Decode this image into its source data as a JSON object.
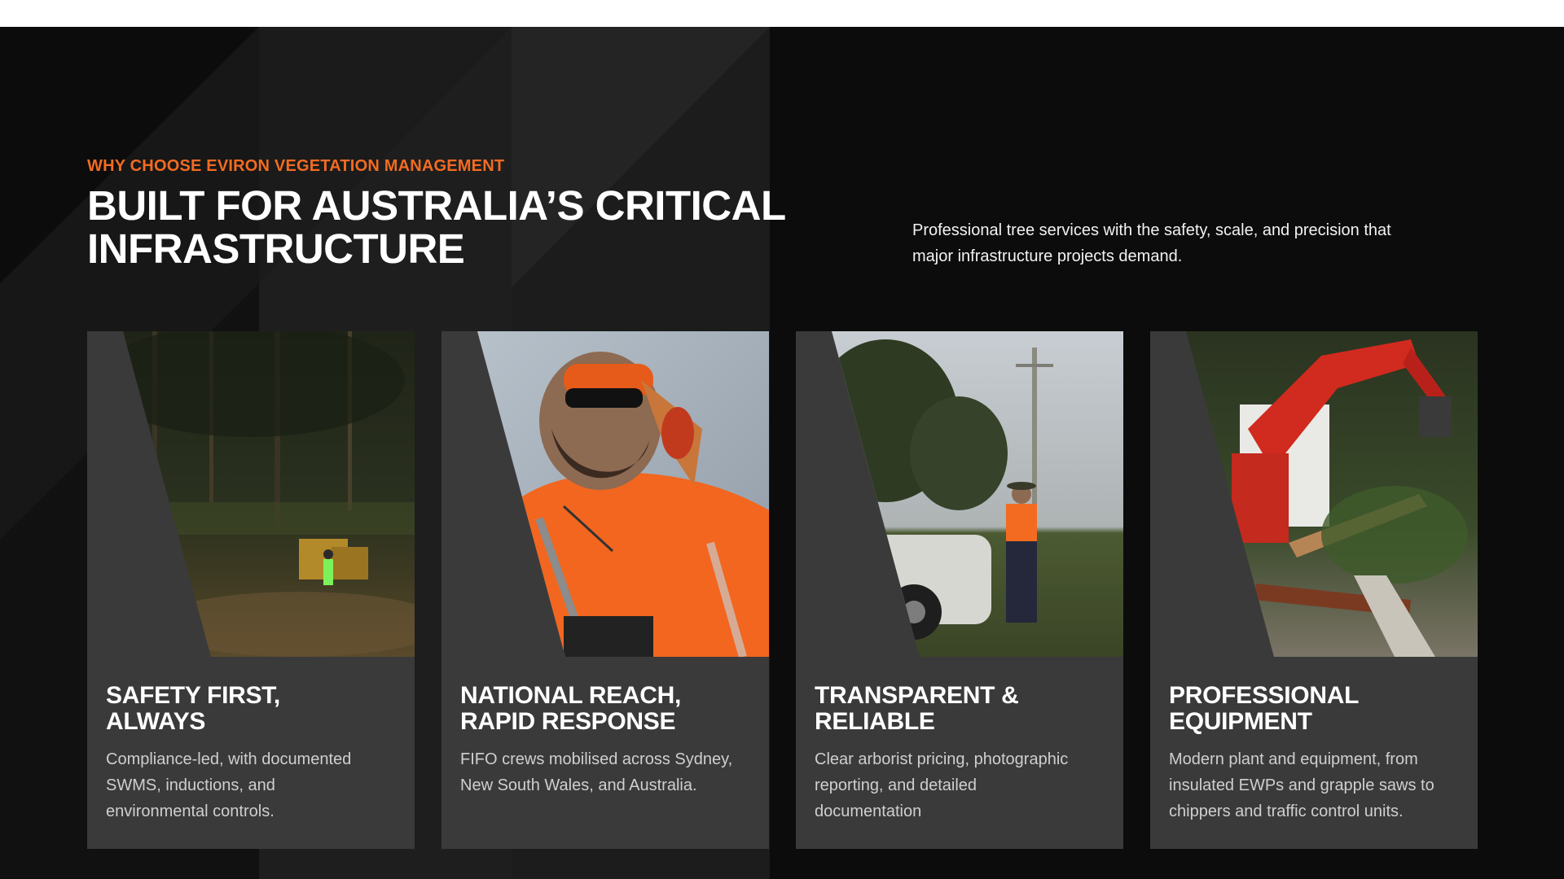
{
  "section": {
    "eyebrow": "WHY CHOOSE EVIRON VEGETATION MANAGEMENT",
    "heading_line1": "BUILT FOR AUSTRALIA’S CRITICAL",
    "heading_line2": "INFRASTRUCTURE",
    "intro_line1": "Professional tree services with the safety, scale, and precision that",
    "intro_line2": "major infrastructure projects demand."
  },
  "colors": {
    "accent": "#f26b21",
    "background": "#0c0c0c",
    "card": "#3a3a3a"
  },
  "cards": [
    {
      "title_line1": "SAFETY FIRST,",
      "title_line2": "ALWAYS",
      "desc_line1": "Compliance-led, with documented",
      "desc_line2": "SWMS, inductions, and",
      "desc_line3": "environmental controls.",
      "image": "forest-mulcher-worker-photo"
    },
    {
      "title_line1": "NATIONAL REACH,",
      "title_line2": "RAPID RESPONSE",
      "desc_line1": "FIFO crews mobilised across Sydney,",
      "desc_line2": "New South Wales, and Australia.",
      "image": "worker-hi-vis-portrait-photo"
    },
    {
      "title_line1": "TRANSPARENT &",
      "title_line2": "RELIABLE",
      "desc_line1": "Clear arborist pricing, photographic",
      "desc_line2": "reporting, and detailed",
      "desc_line3": "documentation",
      "image": "arborist-by-vehicle-powerline-photo"
    },
    {
      "title_line1": "PROFESSIONAL",
      "title_line2": "EQUIPMENT",
      "desc_line1": "Modern plant and equipment, from",
      "desc_line2": "insulated EWPs and grapple saws to",
      "desc_line3": "chippers and traffic control units.",
      "image": "excavator-grapple-saw-photo"
    }
  ]
}
